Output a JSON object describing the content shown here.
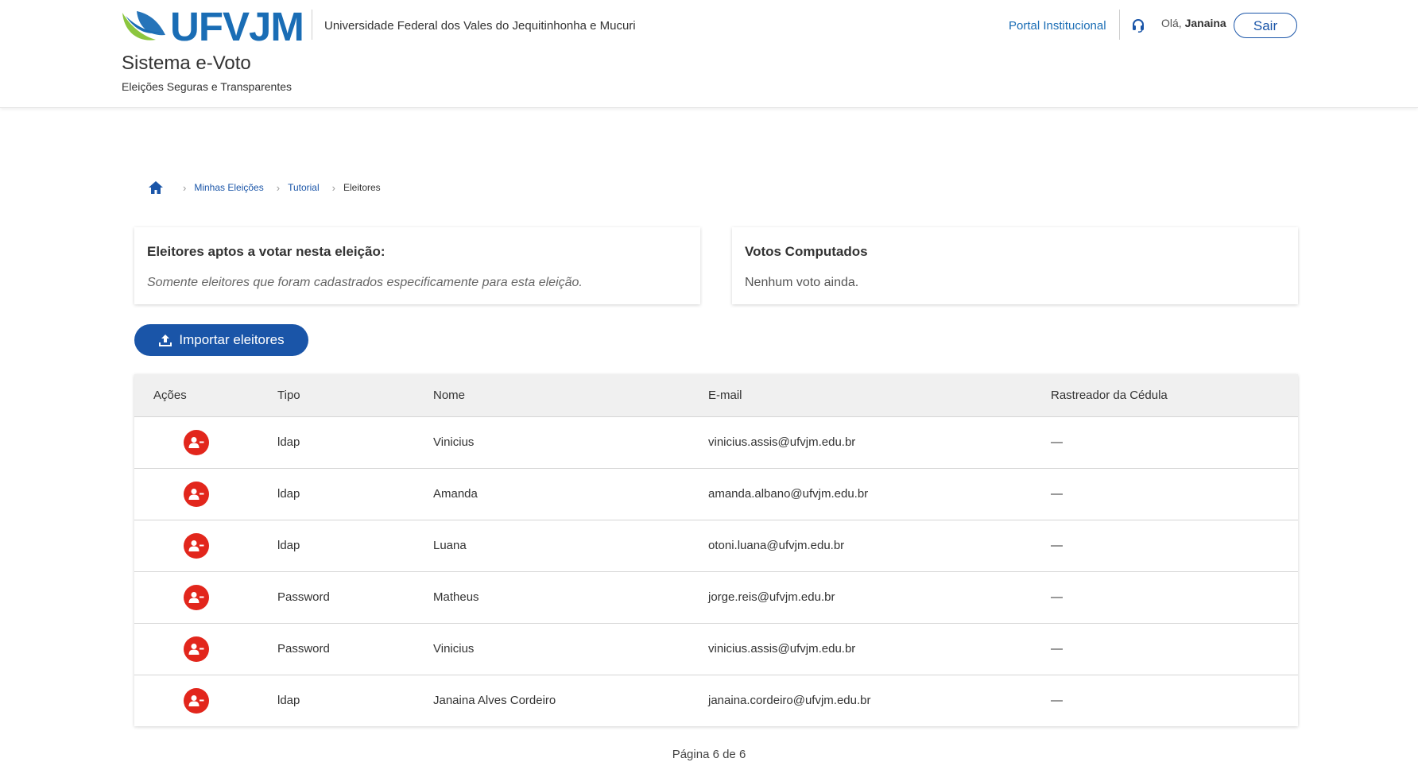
{
  "header": {
    "logo_text": "UFVJM",
    "university": "Universidade Federal dos Vales do Jequitinhonha e Mucuri",
    "system_title": "Sistema e-Voto",
    "system_subtitle": "Eleições Seguras e Transparentes",
    "portal_link": "Portal Institucional",
    "greeting": "Olá,",
    "user_name": "Janaina",
    "logout_label": "Sair",
    "icons": [
      "headset-icon"
    ]
  },
  "breadcrumb": {
    "home_icon": "home-icon",
    "items": [
      "Minhas Eleições",
      "Tutorial"
    ],
    "current": "Eleitores"
  },
  "cards": {
    "voters": {
      "title": "Eleitores aptos a votar nesta eleição:",
      "text": "Somente eleitores que foram cadastrados especificamente para esta eleição."
    },
    "votes": {
      "title": "Votos Computados",
      "text": "Nenhum voto ainda."
    }
  },
  "import_button": {
    "label": "Importar eleitores",
    "icon": "upload-icon"
  },
  "table": {
    "columns": [
      "Ações",
      "Tipo",
      "Nome",
      "E-mail",
      "Rastreador da Cédula"
    ],
    "action_icon": "remove-user-icon",
    "rows": [
      {
        "tipo": "ldap",
        "nome": "Vinicius",
        "email": "vinicius.assis@ufvjm.edu.br",
        "rastreador": "—"
      },
      {
        "tipo": "ldap",
        "nome": "Amanda",
        "email": "amanda.albano@ufvjm.edu.br",
        "rastreador": "—"
      },
      {
        "tipo": "ldap",
        "nome": "Luana",
        "email": "otoni.luana@ufvjm.edu.br",
        "rastreador": "—"
      },
      {
        "tipo": "Password",
        "nome": "Matheus",
        "email": "jorge.reis@ufvjm.edu.br",
        "rastreador": "—"
      },
      {
        "tipo": "Password",
        "nome": "Vinicius",
        "email": "vinicius.assis@ufvjm.edu.br",
        "rastreador": "—"
      },
      {
        "tipo": "ldap",
        "nome": "Janaina Alves Cordeiro",
        "email": "janaina.cordeiro@ufvjm.edu.br",
        "rastreador": "—"
      }
    ]
  },
  "pagination": {
    "text": "Página 6 de 6"
  },
  "colors": {
    "primary": "#1a55a8",
    "brand_blue": "#1a6db5",
    "brand_green": "#8cc63f",
    "danger": "#e2261c"
  }
}
